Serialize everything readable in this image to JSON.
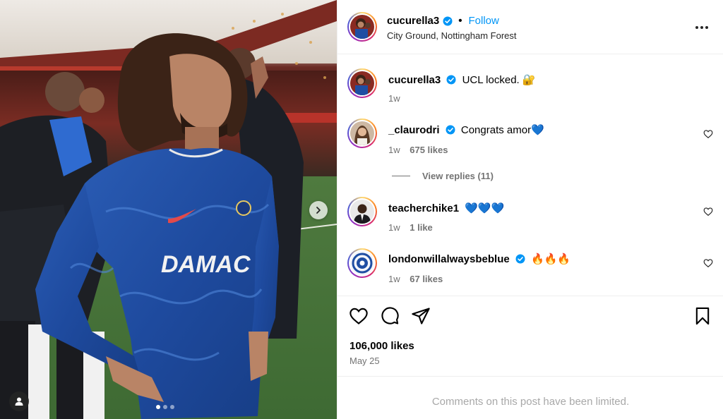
{
  "post": {
    "author": {
      "username": "cucurella3",
      "verified": true,
      "follow_label": "Follow",
      "separator": "•",
      "location": "City Ground, Nottingham Forest"
    },
    "caption": {
      "username": "cucurella3",
      "text": "UCL locked. 🔐",
      "time": "1w"
    },
    "comments": [
      {
        "username": "_claurodri",
        "verified": true,
        "text": "Congrats amor💙",
        "time": "1w",
        "likes": "675 likes"
      },
      {
        "username": "teacherchike1",
        "verified": false,
        "text": "💙💙💙",
        "time": "1w",
        "likes": "1 like"
      },
      {
        "username": "londonwillalwaysbeblue",
        "verified": true,
        "text": "🔥🔥🔥",
        "time": "1w",
        "likes": "67 likes"
      }
    ],
    "view_replies": "View replies (11)",
    "likes_total": "106,000 likes",
    "date": "May 25",
    "comments_limited": "Comments on this post have been limited.",
    "photo": {
      "shirt_text": "DAMAC",
      "carousel_count": 3,
      "carousel_active": 1
    }
  },
  "icons": {
    "verified": "verified-badge-icon",
    "more": "more-options-icon",
    "heart": "heart-icon",
    "comment": "comment-icon",
    "share": "share-icon",
    "save": "bookmark-icon",
    "next": "chevron-right-icon",
    "tag": "user-tag-icon"
  },
  "colors": {
    "accent": "#0095f6",
    "chelsea_blue": "#1f4ea3",
    "muted": "#737373"
  }
}
